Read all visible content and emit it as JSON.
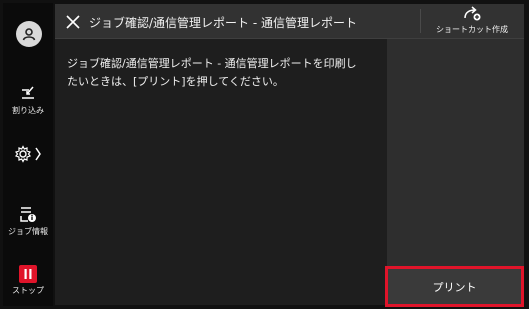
{
  "header": {
    "title": "ジョブ確認/通信管理レポート ‐ 通信管理レポート",
    "shortcut_label": "ショートカット作成"
  },
  "content": {
    "message_line1": "ジョブ確認/通信管理レポート ‐ 通信管理レポートを印刷し",
    "message_line2": "たいときは、[プリント]を押してください。"
  },
  "rail": {
    "interrupt_label": "割り込み",
    "job_info_label": "ジョブ情報",
    "stop_label": "ストップ"
  },
  "actions": {
    "print_label": "プリント"
  },
  "colors": {
    "accent_red": "#e0142a",
    "stop_red": "#e0142a"
  }
}
